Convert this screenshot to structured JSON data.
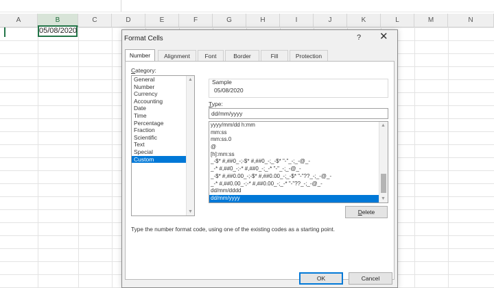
{
  "spreadsheet": {
    "columns": [
      "A",
      "B",
      "C",
      "D",
      "E",
      "F",
      "G",
      "H",
      "I",
      "J",
      "K",
      "L",
      "M",
      "N"
    ],
    "selected_column": "B",
    "active_cell_value": "05/08/2020"
  },
  "dialog": {
    "title": "Format Cells",
    "help_glyph": "?",
    "close_glyph": "✕",
    "tabs": [
      {
        "label": "Number"
      },
      {
        "label": "Alignment"
      },
      {
        "label": "Font"
      },
      {
        "label": "Border"
      },
      {
        "label": "Fill"
      },
      {
        "label": "Protection"
      }
    ],
    "active_tab": "Number",
    "category_label_first": "C",
    "category_label_rest": "ategory:",
    "categories": [
      "General",
      "Number",
      "Currency",
      "Accounting",
      "Date",
      "Time",
      "Percentage",
      "Fraction",
      "Scientific",
      "Text",
      "Special",
      "Custom"
    ],
    "selected_category": "Custom",
    "sample_label": "Sample",
    "sample_value": "05/08/2020",
    "type_label_first": "T",
    "type_label_rest": "ype:",
    "type_value": "dd/mm/yyyy",
    "format_codes": [
      "yyyy/mm/dd h:mm",
      "mm:ss",
      "mm:ss.0",
      "@",
      "[h]:mm:ss",
      "_-$* #,##0_-;-$* #,##0_-;_-$* \"-\"_-;_-@_-",
      "_-* #,##0_-;-* #,##0_-;_-* \"-\"_-;_-@_-",
      "_-$* #,##0.00_-;-$* #,##0.00_-;_-$* \"-\"??_-;_-@_-",
      "_-* #,##0.00_-;-* #,##0.00_-;_-* \"-\"??_-;_-@_-",
      "dd/mm/dddd",
      "dd/mm/yyyy"
    ],
    "selected_format": "dd/mm/yyyy",
    "delete_label_first": "D",
    "delete_label_rest": "elete",
    "hint": "Type the number format code, using one of the existing codes as a starting point.",
    "ok_label": "OK",
    "cancel_label": "Cancel"
  },
  "colors": {
    "selection": "#0078d7",
    "excel_green": "#217346",
    "dialog_bg": "#f0f0f0"
  },
  "icons": {
    "scroll_up": "scroll-up-arrow-icon",
    "scroll_down": "scroll-down-arrow-icon"
  }
}
